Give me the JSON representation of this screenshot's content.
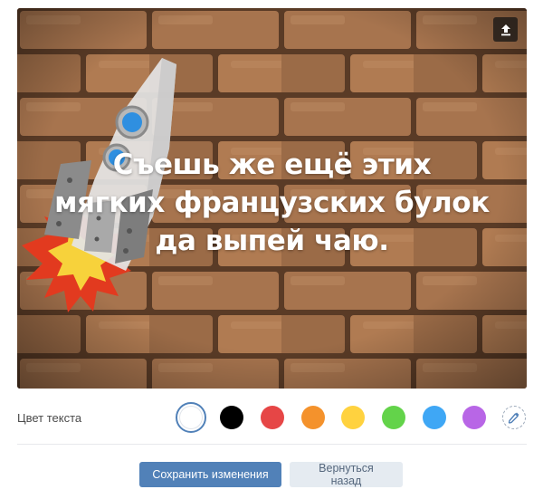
{
  "canvas": {
    "overlay_text": "Съешь же ещё этих мягких французских булок да выпей чаю.",
    "upload_icon": "upload-icon"
  },
  "text_color": {
    "label": "Цвет текста",
    "selected": "white",
    "swatches": [
      {
        "name": "white",
        "hex": "#ffffff"
      },
      {
        "name": "black",
        "hex": "#000000"
      },
      {
        "name": "red",
        "hex": "#e64646"
      },
      {
        "name": "orange",
        "hex": "#f4922c"
      },
      {
        "name": "yellow",
        "hex": "#ffd23f"
      },
      {
        "name": "green",
        "hex": "#63d34a"
      },
      {
        "name": "blue",
        "hex": "#3fa7f5"
      },
      {
        "name": "purple",
        "hex": "#b866e6"
      }
    ],
    "picker_icon": "eyedropper-icon"
  },
  "actions": {
    "save_label": "Сохранить изменения",
    "back_label": "Вернуться назад"
  }
}
